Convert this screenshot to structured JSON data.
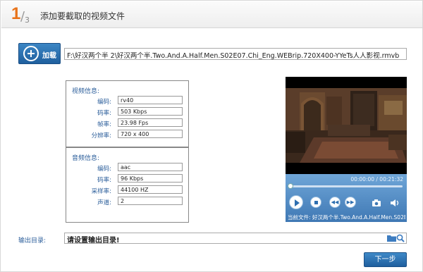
{
  "header": {
    "step_current": "1",
    "step_slash": "/",
    "step_total": "3",
    "title": "添加要截取的视频文件"
  },
  "add_button": {
    "label": "加载",
    "icon": "plus-circle-icon"
  },
  "file_path": "F:\\好汉两个半 2\\好汉两个半.Two.And.A.Half.Men.S02E07.Chi_Eng.WEBrip.720X400-YYeTs人人影视.rmvb",
  "video_info": {
    "title": "视频信息:",
    "rows": [
      {
        "label": "编码:",
        "value": "rv40"
      },
      {
        "label": "码率:",
        "value": "503 Kbps"
      },
      {
        "label": "帧率:",
        "value": "23.98 Fps"
      },
      {
        "label": "分辨率:",
        "value": "720 x 400"
      }
    ]
  },
  "audio_info": {
    "title": "音频信息:",
    "rows": [
      {
        "label": "编码:",
        "value": "aac"
      },
      {
        "label": "码率:",
        "value": "96 Kbps"
      },
      {
        "label": "采样率:",
        "value": "44100 HZ"
      },
      {
        "label": "声道:",
        "value": "2"
      }
    ]
  },
  "player": {
    "time": "00:00:00 / 00:21:32",
    "progress": 0,
    "current_file": "当前文件: 好汉两个半.Two.And.A.Half.Men.S02E07",
    "icons": [
      "play-icon",
      "stop-icon",
      "rewind-icon",
      "fast-forward-icon",
      "camera-icon",
      "volume-icon"
    ]
  },
  "output": {
    "label": "输出目录:",
    "value": "请设置输出目录!"
  },
  "next_button": {
    "label": "下一步"
  },
  "colors": {
    "accent_orange": "#e8731a",
    "primary_blue": "#2e6fb0",
    "label_blue": "#2a5d9a"
  }
}
